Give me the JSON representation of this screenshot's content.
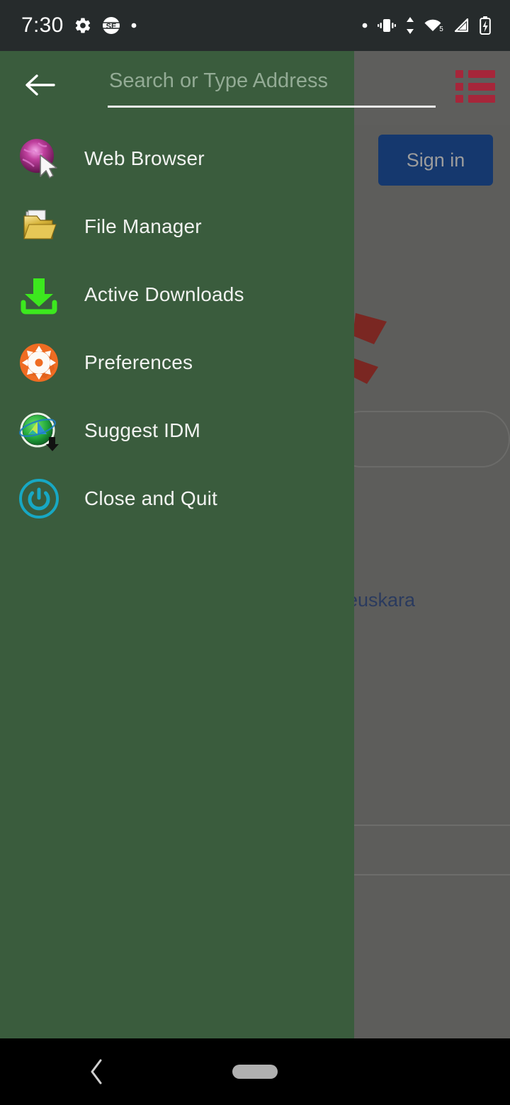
{
  "status_bar": {
    "time": "7:30",
    "left_icons": [
      "gear-icon",
      "se-app-icon",
      "dot-icon"
    ],
    "right_icons": [
      "dot-icon",
      "vibrate-icon",
      "data-transfer-icon",
      "wifi-5-icon",
      "signal-icon",
      "battery-charging-icon"
    ],
    "wifi_badge": "5",
    "background_color": "#262b2c"
  },
  "toolbar": {
    "back_icon": "arrow-left-icon",
    "search_placeholder": "Search or Type Address",
    "search_value": "",
    "menu_icon": "list-icon",
    "menu_icon_color": "#a6263a"
  },
  "drawer": {
    "background_color": "#3a5c3d",
    "items": [
      {
        "label": "Web Browser",
        "icon": "globe-cursor-icon"
      },
      {
        "label": "File Manager",
        "icon": "folder-icon"
      },
      {
        "label": "Active Downloads",
        "icon": "download-tray-icon"
      },
      {
        "label": "Preferences",
        "icon": "gear-circle-icon"
      },
      {
        "label": "Suggest IDM",
        "icon": "idm-logo-icon"
      },
      {
        "label": "Close and Quit",
        "icon": "power-icon"
      }
    ]
  },
  "background_page": {
    "sign_in_label": "Sign in",
    "sign_in_color": "#15386e",
    "language_text": "euskara",
    "language_color": "#2a3a5e",
    "scrim_color": "#5e5e5c",
    "search_box": "rounded-search-field"
  },
  "nav_bar": {
    "background_color": "#000000",
    "back_icon": "chevron-left-icon",
    "home_icon": "home-pill-icon"
  }
}
